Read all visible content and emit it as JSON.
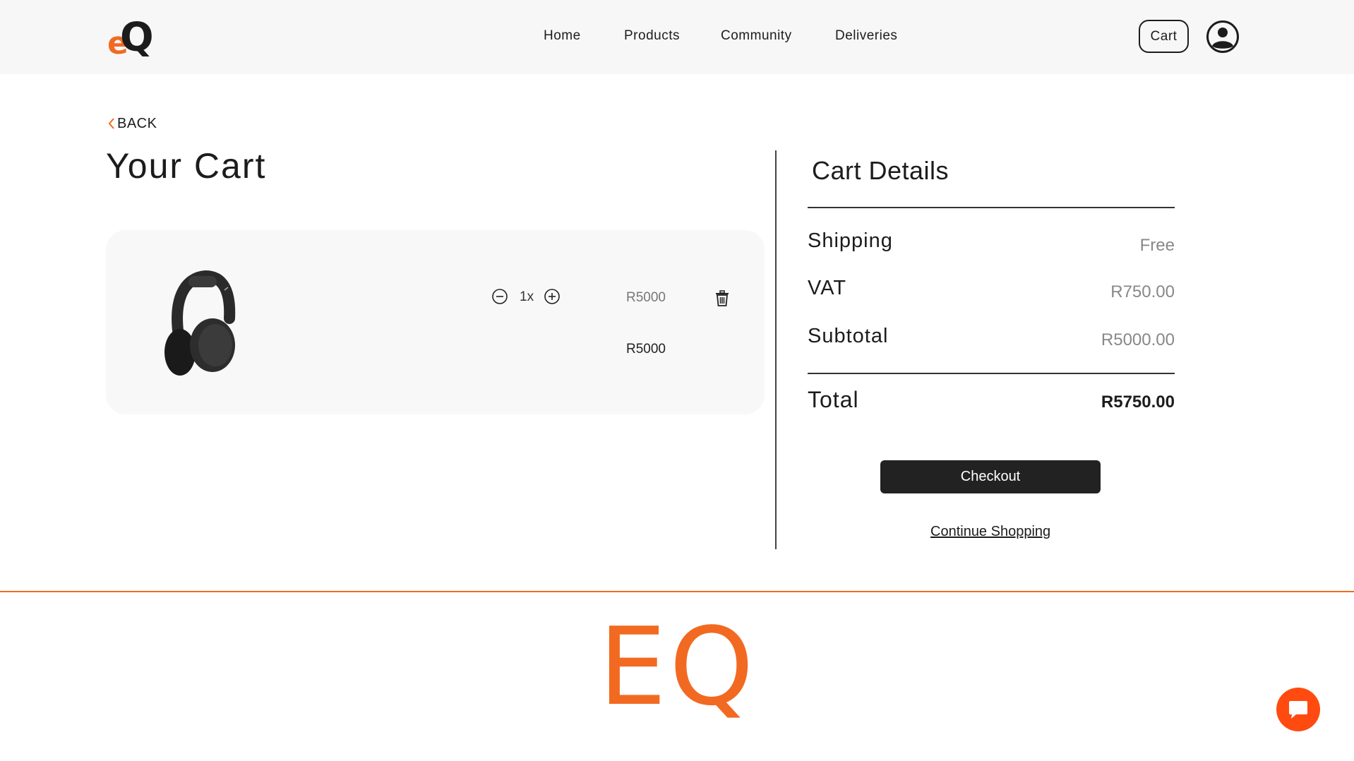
{
  "header": {
    "logo": "eQ",
    "nav": [
      "Home",
      "Products",
      "Community",
      "Deliveries"
    ],
    "cart_label": "Cart",
    "user_icon": "user-circle-icon"
  },
  "back_label": "BACK",
  "page_title": "Your Cart",
  "cart_item": {
    "image": "headphones-icon",
    "quantity": "1x",
    "unit_price": "R5000",
    "line_total": "R5000"
  },
  "details": {
    "title": "Cart Details",
    "rows": [
      {
        "label": "Shipping",
        "value": "Free"
      },
      {
        "label": "VAT",
        "value": "R750.00"
      },
      {
        "label": "Subtotal",
        "value": "R5000.00"
      }
    ],
    "total_label": "Total",
    "total_value": "R5750.00",
    "checkout_label": "Checkout",
    "continue_label": "Continue Shopping"
  },
  "footer": {
    "logo": "EQ"
  },
  "colors": {
    "accent": "#f26a21",
    "dark": "#1c1c1c",
    "chat": "#ff4b10"
  }
}
